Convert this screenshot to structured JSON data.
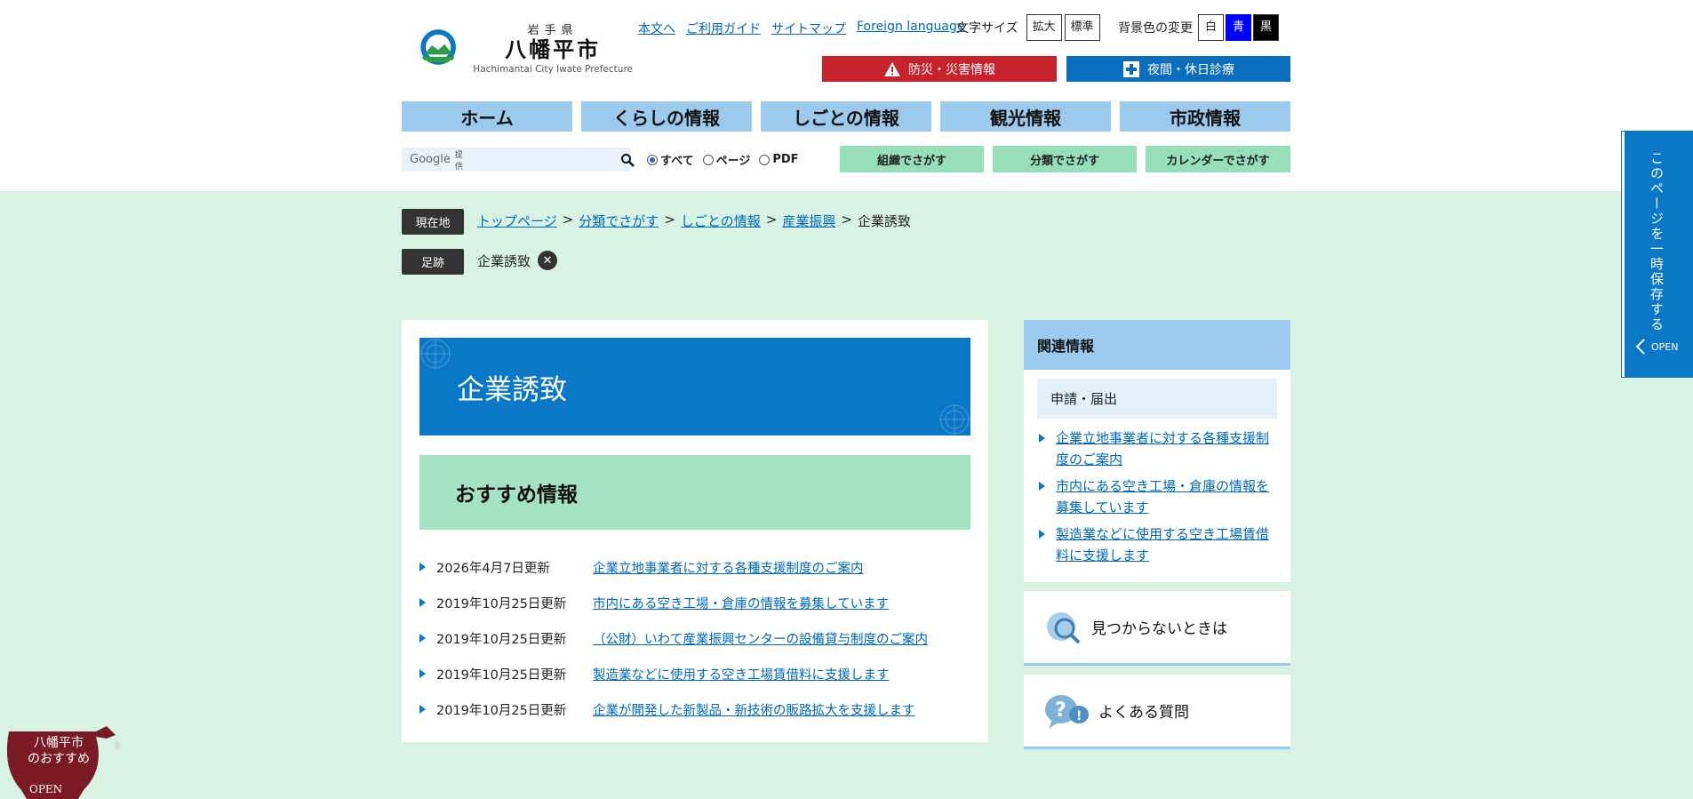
{
  "header": {
    "logo": {
      "prefecture": "岩手県",
      "city": "八幡平市",
      "english": "Hachimantai City Iwate Prefecture"
    },
    "util_links": [
      "本文へ",
      "ご利用ガイド",
      "サイトマップ",
      "Foreign language"
    ],
    "font_size": {
      "label": "文字サイズ",
      "larger": "拡大",
      "standard": "標準"
    },
    "bg_color": {
      "label": "背景色の変更",
      "white": "白",
      "blue": "青",
      "black": "黒"
    },
    "disaster_button": "防災・災害情報",
    "night_button": "夜間・休日診療",
    "colors": {
      "alert": "#c7232d",
      "accent": "#0a78c6",
      "nav": "#9ccaec",
      "green": "#96dfb8",
      "bg": "#d8f3e4"
    }
  },
  "gnav": [
    "ホーム",
    "くらしの情報",
    "しごとの情報",
    "観光情報",
    "市政情報"
  ],
  "search": {
    "google": "Google",
    "provided": "提供",
    "placeholder": ""
  },
  "radios": [
    {
      "label": "すべて",
      "checked": true
    },
    {
      "label": "ページ",
      "checked": false
    },
    {
      "label": "PDF",
      "checked": false
    }
  ],
  "find_buttons": [
    "組織でさがす",
    "分類でさがす",
    "カレンダーでさがす"
  ],
  "breadcrumb": {
    "tag": "現在地",
    "links": [
      "トップページ",
      "分類でさがす",
      "しごとの情報",
      "産業振興"
    ],
    "separator": ">",
    "current": "企業誘致"
  },
  "footprint": {
    "tag": "足跡",
    "item": "企業誘致",
    "close": "✕"
  },
  "main": {
    "title": "企業誘致",
    "recommend_heading": "おすすめ情報",
    "news": [
      {
        "date": "2026年4月7日更新",
        "title": "企業立地事業者に対する各種支援制度のご案内"
      },
      {
        "date": "2019年10月25日更新",
        "title": "市内にある空き工場・倉庫の情報を募集しています"
      },
      {
        "date": "2019年10月25日更新",
        "title": "（公財）いわて産業振興センターの設備貸与制度のご案内"
      },
      {
        "date": "2019年10月25日更新",
        "title": "製造業などに使用する空き工場賃借料に支援します"
      },
      {
        "date": "2019年10月25日更新",
        "title": "企業が開発した新製品・新技術の販路拡大を支援します"
      }
    ]
  },
  "sidebar": {
    "heading": "関連情報",
    "sub": "申請・届出",
    "links": [
      "企業立地事業者に対する各種支援制度のご案内",
      "市内にある空き工場・倉庫の情報を募集しています",
      "製造業などに使用する空き工場賃借料に支援します"
    ],
    "not_found": "見つからないときは",
    "faq": "よくある質問"
  },
  "save_tab": {
    "text": "このページを一時保存する",
    "open": "OPEN"
  },
  "osusume": {
    "line1": "八幡平市",
    "line2": "のおすすめ",
    "open": "OPEN"
  }
}
